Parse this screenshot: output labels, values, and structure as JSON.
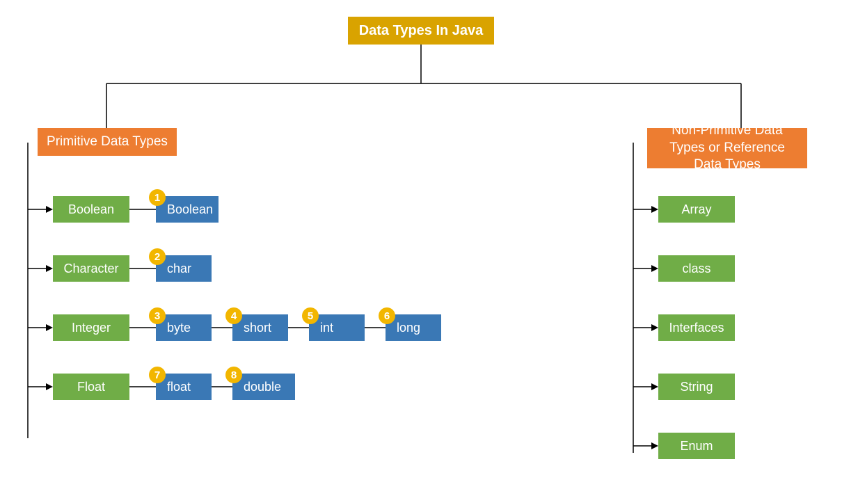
{
  "title": "Data Types In Java",
  "primitive": {
    "header": "Primitive Data Types",
    "categories": {
      "boolean": "Boolean",
      "character": "Character",
      "integer": "Integer",
      "float": "Float"
    },
    "leaves": {
      "boolean": {
        "num": "1",
        "label": "Boolean"
      },
      "char": {
        "num": "2",
        "label": "char"
      },
      "byte": {
        "num": "3",
        "label": "byte"
      },
      "short": {
        "num": "4",
        "label": "short"
      },
      "int": {
        "num": "5",
        "label": "int"
      },
      "long": {
        "num": "6",
        "label": "long"
      },
      "floatl": {
        "num": "7",
        "label": "float"
      },
      "double": {
        "num": "8",
        "label": "double"
      }
    }
  },
  "nonprimitive": {
    "header": "Non-Primitive Data Types or Reference Data Types",
    "items": {
      "array": "Array",
      "class": "class",
      "interfaces": "Interfaces",
      "string": "String",
      "enum": "Enum"
    }
  }
}
